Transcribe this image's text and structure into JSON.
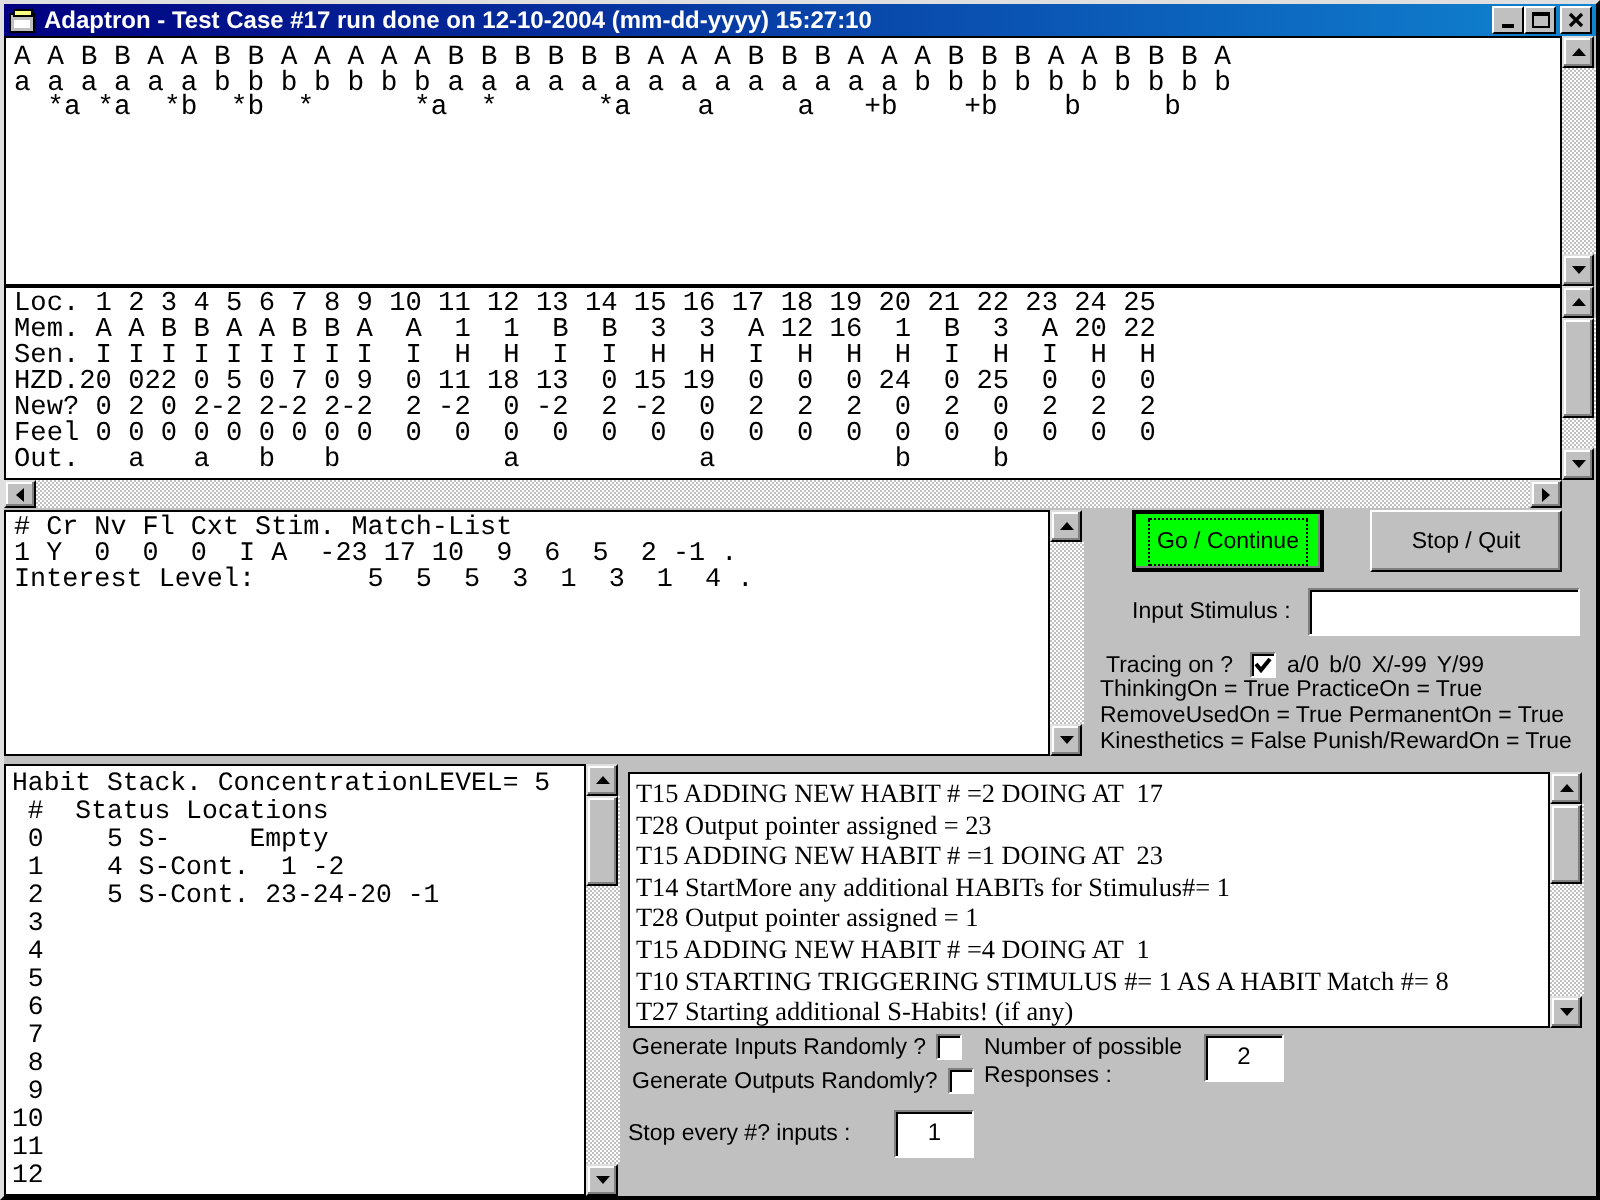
{
  "window": {
    "title": "Adaptron - Test Case #17 run done on 12-10-2004 (mm-dd-yyyy) 15:27:10"
  },
  "sequence_pane": {
    "lines": [
      "A A B B A A B B A A A A A B B B B B B A A A B B B A A A B B B A A B B B A",
      "a a a a a a b b b b b b b a a a a a a a a a a a a a a b b b b b b b b b b",
      "  *a *a  *b  *b  *      *a  *      *a    a     a   +b    +b    b     b"
    ]
  },
  "memory_grid": {
    "rows": [
      {
        "label": "Loc.",
        "cells": [
          "1",
          "2",
          "3",
          "4",
          "5",
          "6",
          "7",
          "8",
          "9",
          "10",
          "11",
          "12",
          "13",
          "14",
          "15",
          "16",
          "17",
          "18",
          "19",
          "20",
          "21",
          "22",
          "23",
          "24",
          "25"
        ]
      },
      {
        "label": "Mem.",
        "cells": [
          "A",
          "A",
          "B",
          "B",
          "A",
          "A",
          "B",
          "B",
          "A",
          "A",
          "1",
          "1",
          "B",
          "B",
          "3",
          "3",
          "A",
          "12",
          "16",
          "1",
          "B",
          "3",
          "A",
          "20",
          "22"
        ]
      },
      {
        "label": "Sen.",
        "cells": [
          "I",
          "I",
          "I",
          "I",
          "I",
          "I",
          "I",
          "I",
          "I",
          "I",
          "H",
          "H",
          "I",
          "I",
          "H",
          "H",
          "I",
          "H",
          "H",
          "H",
          "I",
          "H",
          "I",
          "H",
          "H"
        ]
      },
      {
        "label": "HZD.",
        "cells": [
          "20",
          "0",
          "22",
          "0",
          "5",
          "0",
          "7",
          "0",
          "9",
          "0",
          "11",
          "18",
          "13",
          "0",
          "15",
          "19",
          "0",
          "0",
          "0",
          "24",
          "0",
          "25",
          "0",
          "0",
          "0"
        ]
      },
      {
        "label": "New?",
        "cells": [
          "0",
          "2",
          "0",
          "2",
          "-2",
          "2",
          "-2",
          "2",
          "-2",
          "2",
          "-2",
          "0",
          "-2",
          "2",
          "-2",
          "0",
          "2",
          "2",
          "2",
          "0",
          "2",
          "0",
          "2",
          "2",
          "2"
        ]
      },
      {
        "label": "Feel",
        "cells": [
          "0",
          "0",
          "0",
          "0",
          "0",
          "0",
          "0",
          "0",
          "0",
          "0",
          "0",
          "0",
          "0",
          "0",
          "0",
          "0",
          "0",
          "0",
          "0",
          "0",
          "0",
          "0",
          "0",
          "0",
          "0"
        ]
      },
      {
        "label": "Out.",
        "cells": [
          null,
          "a",
          null,
          "a",
          null,
          "b",
          null,
          "b",
          null,
          null,
          null,
          "a",
          null,
          null,
          null,
          "a",
          null,
          null,
          null,
          "b",
          null,
          "b",
          null,
          null,
          null
        ]
      }
    ]
  },
  "match_list": {
    "lines": [
      "# Cr Nv Fl Cxt Stim. Match-List",
      "1 Y  0  0  0  I A  -23 17 10  9  6  5  2 -1 .",
      "Interest Level:       5  5  5  3  1  3  1  4 ."
    ]
  },
  "buttons": [
    {
      "label": "Go / Continue",
      "focused": true
    },
    {
      "label": "Stop / Quit",
      "focused": false
    }
  ],
  "input_stimulus": {
    "label": "Input Stimulus :"
  },
  "tracing": {
    "label": "Tracing on ?",
    "checked": true,
    "legend": "a/0  b/0  X/-99  Y/99"
  },
  "flags": [
    "ThinkingOn = True PracticeOn = True",
    "RemoveUsedOn = True PermanentOn = True",
    "Kinesthetics = False Punish/RewardOn = True"
  ],
  "habit_stack": {
    "lines": [
      "Habit Stack. ConcentrationLEVEL= 5",
      " #  Status Locations",
      " 0    5 S-     Empty",
      " 1    4 S-Cont.  1 -2",
      " 2    5 S-Cont. 23-24-20 -1",
      " 3",
      " 4",
      " 5",
      " 6",
      " 7",
      " 8",
      " 9",
      "10",
      "11",
      "12"
    ]
  },
  "trace_log": {
    "lines": [
      "T15 ADDING NEW HABIT # =2 DOING AT  17",
      "T28 Output pointer assigned = 23",
      "T15 ADDING NEW HABIT # =1 DOING AT  23",
      "T14 StartMore any additional HABITs for Stimulus#= 1",
      "T28 Output pointer assigned = 1",
      "T15 ADDING NEW HABIT # =4 DOING AT  1",
      "T10 STARTING TRIGGERING STIMULUS #= 1 AS A HABIT Match #= 8",
      "T27 Starting additional S-Habits! (if any)"
    ]
  },
  "random_options": [
    {
      "label": "Generate Inputs Randomly ?",
      "checked": false
    },
    {
      "label": "Generate Outputs Randomly?",
      "checked": false
    }
  ],
  "responses": {
    "label": "Number of possible Responses :",
    "value": "2"
  },
  "stop_every": {
    "label": "Stop every #? inputs :",
    "value": "1"
  }
}
